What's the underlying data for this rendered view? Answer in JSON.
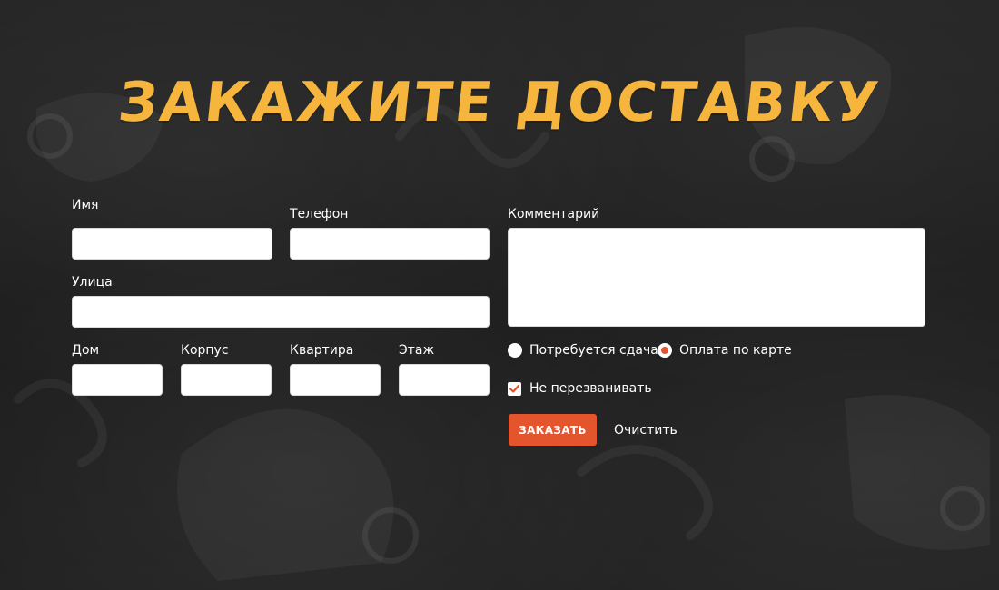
{
  "title": "Закажите доставку",
  "form": {
    "name": {
      "label": "Имя",
      "value": ""
    },
    "phone": {
      "label": "Телефон",
      "value": ""
    },
    "comment": {
      "label": "Комментарий",
      "value": ""
    },
    "street": {
      "label": "Улица",
      "value": ""
    },
    "house": {
      "label": "Дом",
      "value": ""
    },
    "building": {
      "label": "Корпус",
      "value": ""
    },
    "apartment": {
      "label": "Квартира",
      "value": ""
    },
    "floor": {
      "label": "Этаж",
      "value": ""
    }
  },
  "payment": {
    "options": [
      {
        "label": "Потребуется сдача",
        "checked": false
      },
      {
        "label": "Оплата по карте",
        "checked": true
      }
    ]
  },
  "no_callback": {
    "label": "Не перезванивать",
    "checked": true
  },
  "actions": {
    "submit_label": "ЗАКАЗАТЬ",
    "clear_label": "Очистить"
  },
  "colors": {
    "title": "#f6b53c",
    "accent": "#e4542d",
    "background": "#1f1f1f"
  }
}
